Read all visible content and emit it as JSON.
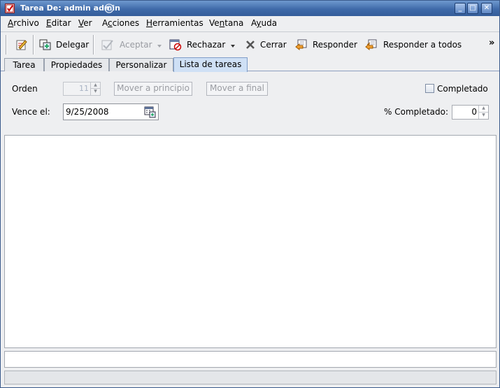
{
  "window": {
    "title": "Tarea De: admin admin",
    "min_glyph": "_",
    "max_glyph": "□",
    "close_glyph": "✕"
  },
  "menu": [
    {
      "label": "Archivo",
      "mnemonic": "A"
    },
    {
      "label": "Editar",
      "mnemonic": "E"
    },
    {
      "label": "Ver",
      "mnemonic": "V"
    },
    {
      "label": "Acciones",
      "mnemonic": "c"
    },
    {
      "label": "Herramientas",
      "mnemonic": "H"
    },
    {
      "label": "Ventana",
      "mnemonic": "n"
    },
    {
      "label": "Ayuda",
      "mnemonic": "y"
    }
  ],
  "toolbar": {
    "delegar": "Delegar",
    "aceptar": "Aceptar",
    "rechazar": "Rechazar",
    "cerrar": "Cerrar",
    "responder": "Responder",
    "responder_todos": "Responder a todos",
    "overflow": "»"
  },
  "tabs": [
    "Tarea",
    "Propiedades",
    "Personalizar",
    "Lista de tareas"
  ],
  "form": {
    "orden_label": "Orden",
    "orden_value": "11",
    "mover_principio": "Mover a principio",
    "mover_final": "Mover a final",
    "completado_label": "Completado",
    "vence_label": "Vence el:",
    "vence_value": "9/25/2008",
    "pct_label": "% Completado:",
    "pct_value": "0"
  },
  "colors": {
    "title_bar": "#3f6aa9",
    "active_tab": "#cfe0f5"
  }
}
